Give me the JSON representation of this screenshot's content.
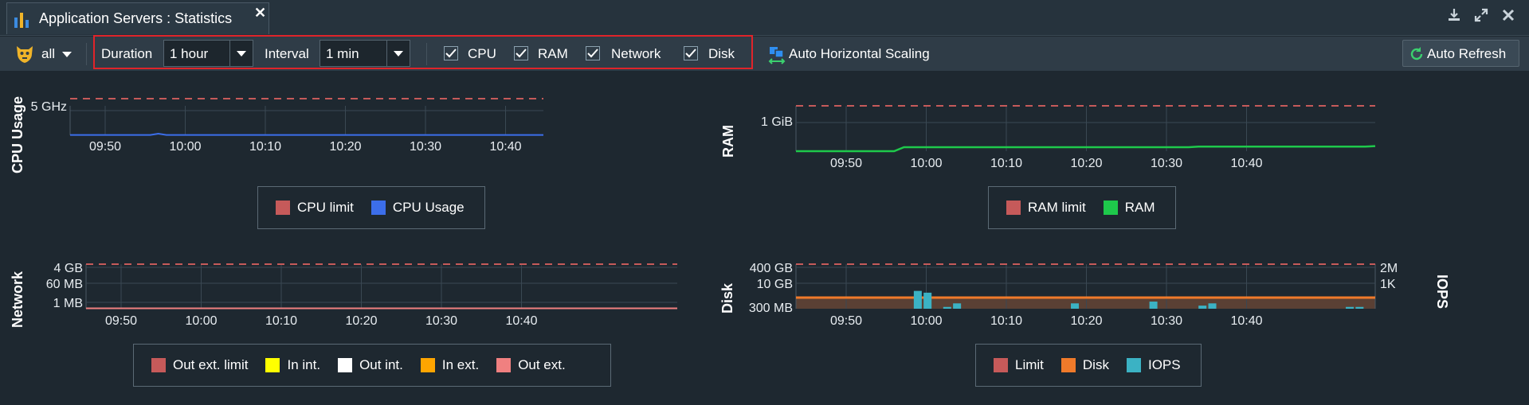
{
  "window": {
    "tab_title": "Application Servers : Statistics",
    "close_glyph": "✕",
    "app_icon": "bar-chart-icon",
    "controls": [
      "download-icon",
      "expand-icon",
      "close-icon"
    ]
  },
  "toolbar": {
    "node_filter": "all",
    "duration_label": "Duration",
    "duration_value": "1 hour",
    "interval_label": "Interval",
    "interval_value": "1 min",
    "checkboxes": [
      {
        "label": "CPU",
        "checked": true
      },
      {
        "label": "RAM",
        "checked": true
      },
      {
        "label": "Network",
        "checked": true
      },
      {
        "label": "Disk",
        "checked": true
      }
    ],
    "auto_scaling_label": "Auto Horizontal Scaling",
    "auto_refresh_label": "Auto Refresh"
  },
  "colors": {
    "limit": "#c65a5a",
    "cpu": "#3c6eea",
    "ram": "#1ec94b",
    "in_int": "#ffff00",
    "out_int": "#ffffff",
    "in_ext": "#ffa500",
    "out_ext": "#f08080",
    "disk": "#f07a2a",
    "iops": "#3bb2c4",
    "highlight": "#e0242a"
  },
  "chart_data": [
    {
      "type": "line",
      "id": "cpu",
      "ylabel": "CPU Usage",
      "x_ticks": [
        "09:50",
        "10:00",
        "10:10",
        "10:20",
        "10:30",
        "10:40"
      ],
      "y_ticks": [
        "5 GHz"
      ],
      "ylim": [
        0,
        7
      ],
      "limit": 7,
      "series": [
        {
          "name": "CPU Usage",
          "color": "#3c6eea",
          "x": [
            0,
            10,
            11,
            12,
            13,
            59
          ],
          "y": [
            0.05,
            0.05,
            0.3,
            0.05,
            0.05,
            0.05
          ]
        }
      ],
      "legend": [
        {
          "label": "CPU limit",
          "color": "#c65a5a"
        },
        {
          "label": "CPU Usage",
          "color": "#3c6eea"
        }
      ]
    },
    {
      "type": "line",
      "id": "ram",
      "ylabel": "RAM",
      "x_ticks": [
        "09:50",
        "10:00",
        "10:10",
        "10:20",
        "10:30",
        "10:40"
      ],
      "y_ticks": [
        "1 GiB"
      ],
      "ylim": [
        0,
        1.6
      ],
      "limit": 1.6,
      "series": [
        {
          "name": "RAM",
          "color": "#1ec94b",
          "x": [
            0,
            10,
            11,
            12,
            13,
            40,
            41,
            58,
            59
          ],
          "y": [
            0,
            0,
            0.14,
            0.14,
            0.14,
            0.14,
            0.16,
            0.16,
            0.18
          ]
        }
      ],
      "legend": [
        {
          "label": "RAM limit",
          "color": "#c65a5a"
        },
        {
          "label": "RAM",
          "color": "#1ec94b"
        }
      ]
    },
    {
      "type": "line",
      "id": "network",
      "ylabel": "Network",
      "x_ticks": [
        "09:50",
        "10:00",
        "10:10",
        "10:20",
        "10:30",
        "10:40"
      ],
      "y_ticks": [
        "4 GB",
        "60 MB",
        "1 MB"
      ],
      "ylim": [
        0,
        10
      ],
      "limit": 10,
      "series": [
        {
          "name": "Out ext.",
          "color": "#f08080",
          "x": [
            0,
            59
          ],
          "y": [
            0.1,
            0.1
          ]
        }
      ],
      "legend": [
        {
          "label": "Out ext. limit",
          "color": "#c65a5a"
        },
        {
          "label": "In int.",
          "color": "#ffff00"
        },
        {
          "label": "Out int.",
          "color": "#ffffff"
        },
        {
          "label": "In ext.",
          "color": "#ffa500"
        },
        {
          "label": "Out ext.",
          "color": "#f08080"
        }
      ]
    },
    {
      "type": "bar",
      "id": "disk",
      "ylabel": "Disk",
      "y2label": "IOPS",
      "x_ticks": [
        "09:50",
        "10:00",
        "10:10",
        "10:20",
        "10:30",
        "10:40"
      ],
      "y_ticks": [
        "400 GB",
        "10 GB",
        "300 MB"
      ],
      "y2_ticks": [
        "2M",
        "1K"
      ],
      "ylim": [
        0,
        10
      ],
      "limit": 10,
      "disk_level": 2.5,
      "iops": [
        {
          "x": 12,
          "v": 4
        },
        {
          "x": 13,
          "v": 3.6
        },
        {
          "x": 15,
          "v": 0.4
        },
        {
          "x": 16,
          "v": 1.2
        },
        {
          "x": 28,
          "v": 1.2
        },
        {
          "x": 36,
          "v": 1.6
        },
        {
          "x": 41,
          "v": 0.7
        },
        {
          "x": 42,
          "v": 1.2
        },
        {
          "x": 56,
          "v": 0.4
        },
        {
          "x": 57,
          "v": 0.4
        }
      ],
      "legend": [
        {
          "label": "Limit",
          "color": "#c65a5a"
        },
        {
          "label": "Disk",
          "color": "#f07a2a"
        },
        {
          "label": "IOPS",
          "color": "#3bb2c4"
        }
      ]
    }
  ]
}
